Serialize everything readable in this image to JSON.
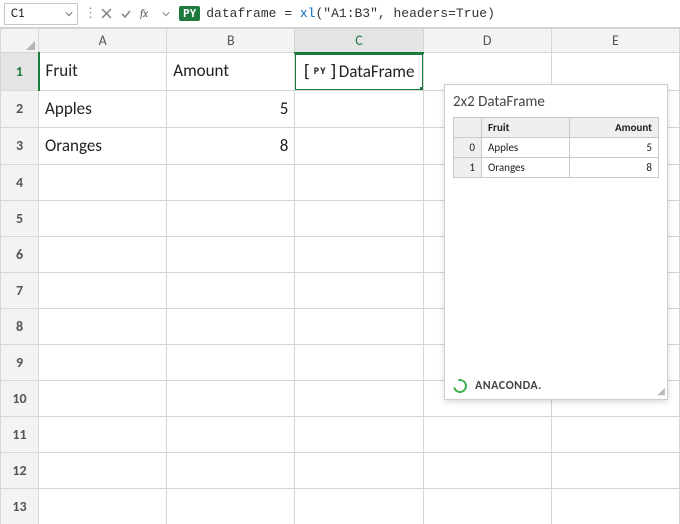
{
  "formula_bar": {
    "cell_ref": "C1",
    "py_badge": "PY",
    "formula_prefix": "dataframe = ",
    "formula_fn": "xl",
    "formula_args": "(\"A1:B3\", headers=True)"
  },
  "columns": [
    "A",
    "B",
    "C",
    "D",
    "E"
  ],
  "rows": [
    1,
    2,
    3,
    4,
    5,
    6,
    7,
    8,
    9,
    10,
    11,
    12,
    13
  ],
  "selected": {
    "row": 1,
    "col": "C"
  },
  "cells": {
    "A1": "Fruit",
    "B1": "Amount",
    "C1_badge": "PY",
    "C1_text": "DataFrame",
    "A2": "Apples",
    "B2": "5",
    "A3": "Oranges",
    "B3": "8"
  },
  "card": {
    "title": "2x2 DataFrame",
    "columns": [
      "Fruit",
      "Amount"
    ],
    "rows": [
      {
        "idx": "0",
        "fruit": "Apples",
        "amount": "5"
      },
      {
        "idx": "1",
        "fruit": "Oranges",
        "amount": "8"
      }
    ],
    "footer": "ANACONDA."
  },
  "chart_data": {
    "type": "table",
    "title": "2x2 DataFrame",
    "columns": [
      "Fruit",
      "Amount"
    ],
    "rows": [
      [
        "Apples",
        5
      ],
      [
        "Oranges",
        8
      ]
    ]
  }
}
